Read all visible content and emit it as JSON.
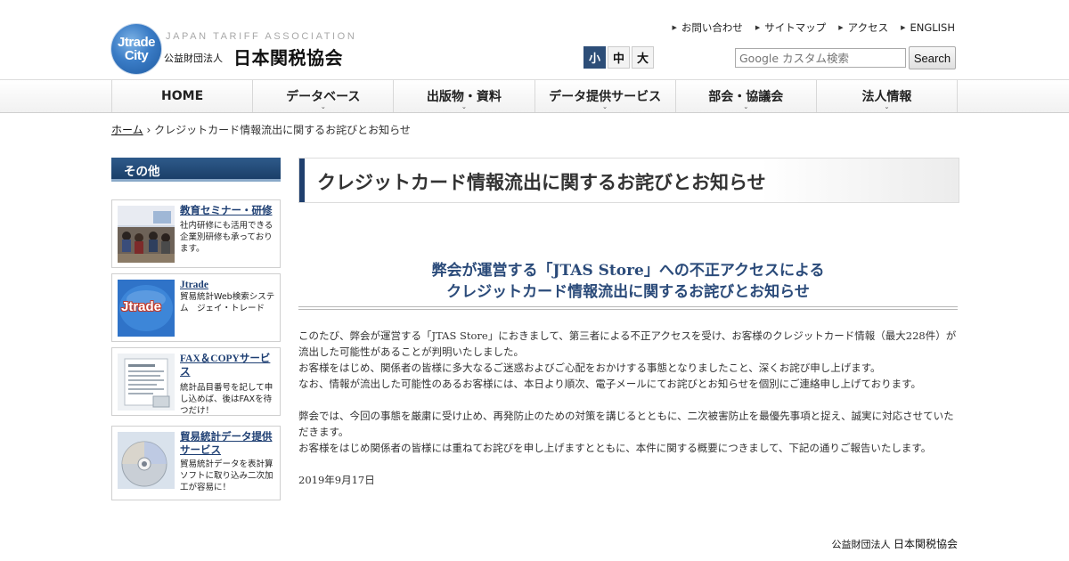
{
  "header": {
    "logo_line1": "Jtrade",
    "logo_line2": "City",
    "org_en": "JAPAN TARIFF ASSOCIATION",
    "org_prefix": "公益財団法人",
    "org_name": "日本関税協会"
  },
  "utility_links": [
    "お問い合わせ",
    "サイトマップ",
    "アクセス",
    "ENGLISH"
  ],
  "font_size": {
    "small": "小",
    "medium": "中",
    "large": "大",
    "selected": "small"
  },
  "search": {
    "placeholder": "Google カスタム検索",
    "button": "Search"
  },
  "nav": [
    "HOME",
    "データベース",
    "出版物・資料",
    "データ提供サービス",
    "部会・協議会",
    "法人情報"
  ],
  "breadcrumb": {
    "home": "ホーム",
    "separator": "›",
    "current": "クレジットカード情報流出に関するお詫びとお知らせ"
  },
  "sidebar": {
    "heading": "その他",
    "cards": [
      {
        "title": "教育セミナー・研修",
        "desc": "社内研修にも活用できる企業別研修も承っております。"
      },
      {
        "title": "Jtrade",
        "desc": "貿易統計Web検索システム　ジェイ・トレード",
        "thumb_label": "Jtrade"
      },
      {
        "title": "FAX＆COPYサービス",
        "desc": "統計品目番号を記して申し込めば、後はFAXを待つだけ！"
      },
      {
        "title": "貿易統計データ提供サービス",
        "desc": "貿易統計データを表計算ソフトに取り込み二次加工が容易に！"
      }
    ]
  },
  "main": {
    "title": "クレジットカード情報流出に関するお詫びとお知らせ",
    "subhead_line1": "弊会が運営する「JTAS Store」への不正アクセスによる",
    "subhead_line2": "クレジットカード情報流出に関するお詫びとお知らせ",
    "para1": "このたび、弊会が運営する「JTAS Store」におきまして、第三者による不正アクセスを受け、お客様のクレジットカード情報（最大228件）が流出した可能性があることが判明いたしました。",
    "para2": "お客様をはじめ、関係者の皆様に多大なるご迷惑およびご心配をおかけする事態となりましたこと、深くお詫び申し上げます。",
    "para3": "なお、情報が流出した可能性のあるお客様には、本日より順次、電子メールにてお詫びとお知らせを個別にご連絡申し上げております。",
    "para4": "弊会では、今回の事態を厳粛に受け止め、再発防止のための対策を講じるとともに、二次被害防止を最優先事項と捉え、誠実に対応させていただきます。",
    "para5": "お客様をはじめ関係者の皆様には重ねてお詫びを申し上げますとともに、本件に関する概要につきまして、下記の通りご報告いたします。",
    "date": "2019年9月17日"
  },
  "footer": {
    "org_prefix": "公益財団法人",
    "org_name": "日本関税協会"
  }
}
